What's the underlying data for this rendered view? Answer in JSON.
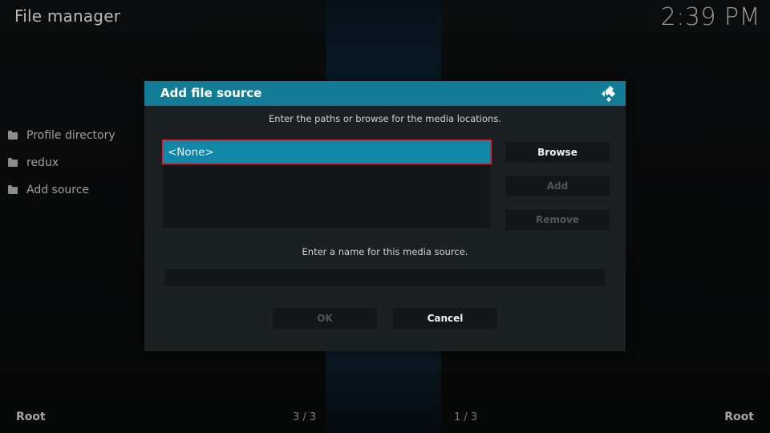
{
  "header": {
    "title": "File manager",
    "clock": "2:39 PM"
  },
  "sidebar": {
    "items": [
      {
        "label": "Profile directory",
        "icon": "folder-icon"
      },
      {
        "label": "redux",
        "icon": "folder-icon"
      },
      {
        "label": "Add source",
        "icon": "folder-icon"
      }
    ]
  },
  "footer": {
    "left_label": "Root",
    "left_count": "3 / 3",
    "right_count": "1 / 3",
    "right_label": "Root"
  },
  "dialog": {
    "title": "Add file source",
    "logo_icon": "kodi-logo-icon",
    "paths_instruction": "Enter the paths or browse for the media locations.",
    "paths": [
      {
        "label": "<None>",
        "selected": true
      }
    ],
    "buttons": {
      "browse": "Browse",
      "add": "Add",
      "remove": "Remove",
      "ok": "OK",
      "cancel": "Cancel"
    },
    "name_instruction": "Enter a name for this media source.",
    "name_value": "",
    "colors": {
      "header": "#127b96",
      "selected_item": "#1186a6",
      "focus_border": "#d0283a"
    }
  }
}
